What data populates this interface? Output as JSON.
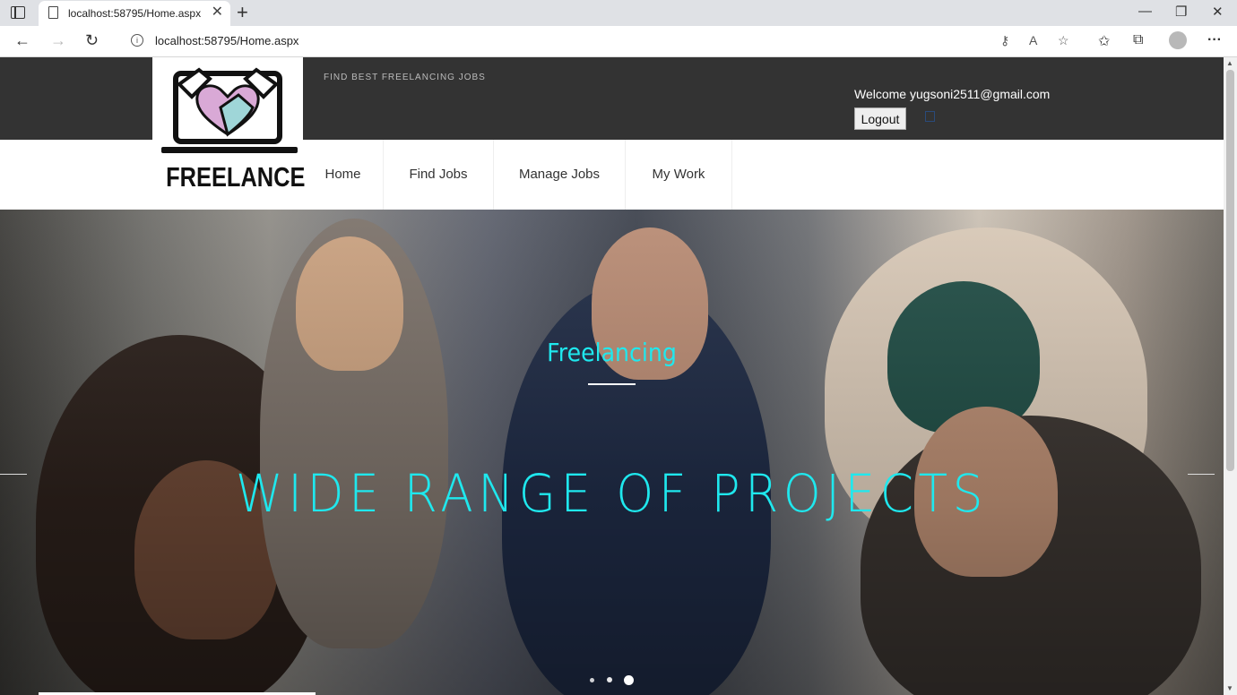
{
  "browser": {
    "tab_title": "localhost:58795/Home.aspx",
    "url": "localhost:58795/Home.aspx"
  },
  "header": {
    "tagline": "FIND BEST FREELANCING JOBS",
    "welcome": "Welcome yugsoni2511@gmail.com",
    "logout_label": "Logout",
    "logo_text": "FREELANCE"
  },
  "nav": {
    "items": [
      "Home",
      "Find Jobs",
      "Manage Jobs",
      "My Work"
    ]
  },
  "hero": {
    "subtitle": "Freelancing",
    "title": "WIDE RANGE OF PROJECTS",
    "active_slide": 3,
    "slide_count": 3
  },
  "colors": {
    "topbar": "#333333",
    "accent_cyan": "#1fe8ee",
    "logo_pink": "#d9a9d6",
    "logo_teal": "#9fd6d8"
  }
}
